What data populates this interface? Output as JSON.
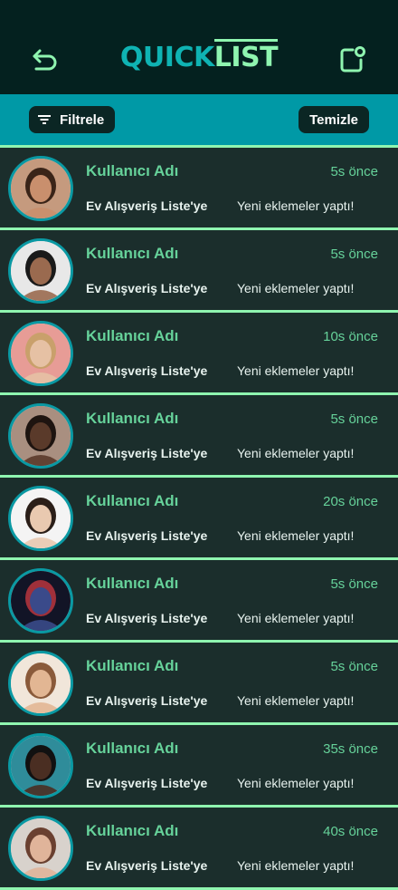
{
  "app": {
    "logo_part1": "QUICK",
    "logo_part2": "LIST"
  },
  "header": {
    "back_icon": "undo-icon",
    "notification_icon": "notification-icon"
  },
  "filters": {
    "filter_label": "Filtrele",
    "clear_label": "Temizle"
  },
  "colors": {
    "accent": "#8ff5b0",
    "brand": "#0fb3b3",
    "bar": "#0099a6",
    "background": "#1b2e2c"
  },
  "notifications": [
    {
      "user": "Kullanıcı Adı",
      "time": "5s önce",
      "list": "Ev Alışveriş Liste'ye",
      "message": "Yeni eklemeler yaptı!",
      "avatar_bg": "#c59a7e",
      "skin": "#c98f6d",
      "hair": "#3a2418"
    },
    {
      "user": "Kullanıcı Adı",
      "time": "5s önce",
      "list": "Ev Alışveriş Liste'ye",
      "message": "Yeni eklemeler yaptı!",
      "avatar_bg": "#e8e8e8",
      "skin": "#9a6a4f",
      "hair": "#1a1a1a"
    },
    {
      "user": "Kullanıcı Adı",
      "time": "10s önce",
      "list": "Ev Alışveriş Liste'ye",
      "message": "Yeni eklemeler yaptı!",
      "avatar_bg": "#e79c96",
      "skin": "#e6c1a4",
      "hair": "#c9a06b"
    },
    {
      "user": "Kullanıcı Adı",
      "time": "5s önce",
      "list": "Ev Alışveriş Liste'ye",
      "message": "Yeni eklemeler yaptı!",
      "avatar_bg": "#a98f80",
      "skin": "#5a3a2a",
      "hair": "#1e1410"
    },
    {
      "user": "Kullanıcı Adı",
      "time": "20s önce",
      "list": "Ev Alışveriş Liste'ye",
      "message": "Yeni eklemeler yaptı!",
      "avatar_bg": "#f4f4f4",
      "skin": "#e9c9b0",
      "hair": "#2a1e18"
    },
    {
      "user": "Kullanıcı Adı",
      "time": "5s önce",
      "list": "Ev Alışveriş Liste'ye",
      "message": "Yeni eklemeler yaptı!",
      "avatar_bg": "#121426",
      "skin": "#3a4a8a",
      "hair": "#a0303a"
    },
    {
      "user": "Kullanıcı Adı",
      "time": "5s önce",
      "list": "Ev Alışveriş Liste'ye",
      "message": "Yeni eklemeler yaptı!",
      "avatar_bg": "#f1e6da",
      "skin": "#e2b693",
      "hair": "#8a5a3a"
    },
    {
      "user": "Kullanıcı Adı",
      "time": "35s önce",
      "list": "Ev Alışveriş Liste'ye",
      "message": "Yeni eklemeler yaptı!",
      "avatar_bg": "#2f8c9a",
      "skin": "#4a2e22",
      "hair": "#111111"
    },
    {
      "user": "Kullanıcı Adı",
      "time": "40s önce",
      "list": "Ev Alışveriş Liste'ye",
      "message": "Yeni eklemeler yaptı!",
      "avatar_bg": "#d8d2cc",
      "skin": "#e0b49a",
      "hair": "#6a4030"
    }
  ]
}
